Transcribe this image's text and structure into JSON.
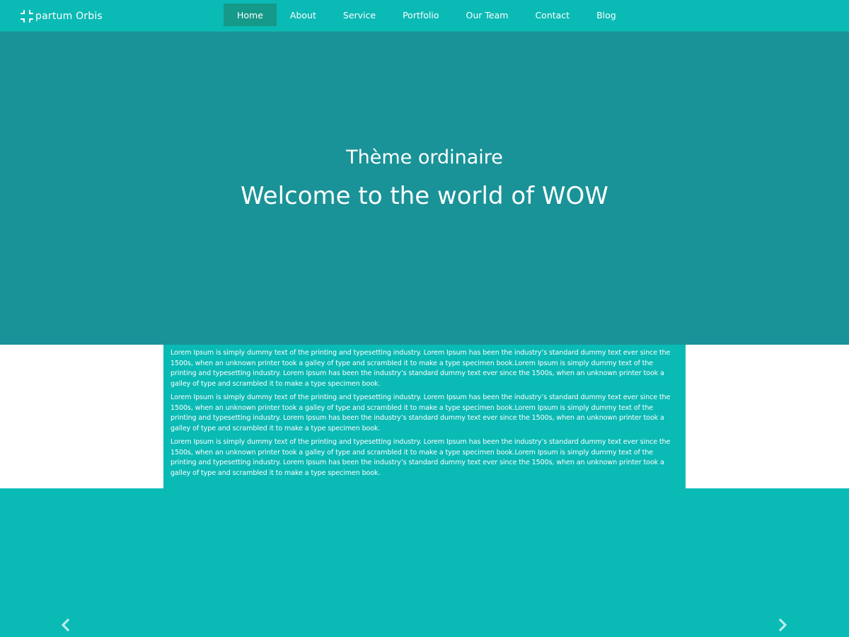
{
  "brand": {
    "name": "partum Orbis",
    "icon": "spark-logo-icon"
  },
  "nav": {
    "items": [
      {
        "label": "Home",
        "active": true
      },
      {
        "label": "About",
        "active": false
      },
      {
        "label": "Service",
        "active": false
      },
      {
        "label": "Portfolio",
        "active": false
      },
      {
        "label": "Our Team",
        "active": false
      },
      {
        "label": "Contact",
        "active": false
      },
      {
        "label": "Blog",
        "active": false
      }
    ]
  },
  "hero": {
    "subtitle": "Thème ordinaire",
    "title": "Welcome to the world of WOW"
  },
  "content": {
    "paragraphs": [
      "Lorem Ipsum is simply dummy text of the printing and typesetting industry. Lorem Ipsum has been the industry’s standard dummy text ever since the 1500s, when an unknown printer took a galley of type and scrambled it to make a type specimen book.Lorem Ipsum is simply dummy text of the printing and typesetting industry. Lorem Ipsum has been the industry’s standard dummy text ever since the 1500s, when an unknown printer took a galley of type and scrambled it to make a type specimen book.",
      "Lorem Ipsum is simply dummy text of the printing and typesetting industry. Lorem Ipsum has been the industry’s standard dummy text ever since the 1500s, when an unknown printer took a galley of type and scrambled it to make a type specimen book.Lorem Ipsum is simply dummy text of the printing and typesetting industry. Lorem Ipsum has been the industry’s standard dummy text ever since the 1500s, when an unknown printer took a galley of type and scrambled it to make a type specimen book.",
      "Lorem Ipsum is simply dummy text of the printing and typesetting industry. Lorem Ipsum has been the industry’s standard dummy text ever since the 1500s, when an unknown printer took a galley of type and scrambled it to make a type specimen book.Lorem Ipsum is simply dummy text of the printing and typesetting industry. Lorem Ipsum has been the industry’s standard dummy text ever since the 1500s, when an unknown printer took a galley of type and scrambled it to make a type specimen book."
    ]
  },
  "carousel": {
    "prev_icon": "chevron-left-icon",
    "next_icon": "chevron-right-icon"
  },
  "colors": {
    "primary": "#0abab5",
    "hero_bg": "#1a9398",
    "nav_active": "#159988",
    "band_bg": "#ffffff",
    "text": "#ffffff"
  }
}
